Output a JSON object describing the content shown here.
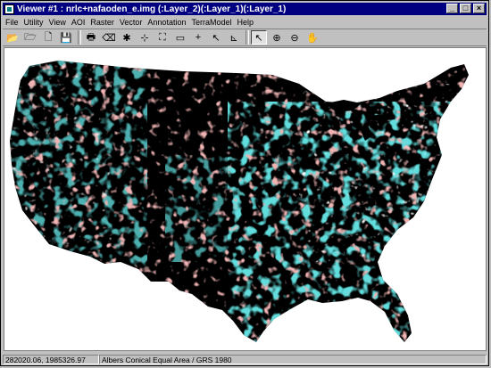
{
  "window": {
    "title": "Viewer #1 : nrlc+nafaoden_e.img (:Layer_2)(:Layer_1)(:Layer_1)",
    "buttons": [
      "_",
      "□",
      "×"
    ]
  },
  "menu": [
    "File",
    "Utility",
    "View",
    "AOI",
    "Raster",
    "Vector",
    "Annotation",
    "TerraModel",
    "Help"
  ],
  "toolbar": {
    "tools": [
      {
        "name": "open-icon",
        "glyph": "📂"
      },
      {
        "name": "open-layer-icon",
        "glyph": "🗁"
      },
      {
        "name": "new-icon",
        "glyph": "🗋"
      },
      {
        "name": "save-icon",
        "glyph": "💾"
      },
      {
        "name": "print-icon",
        "glyph": "🖶"
      },
      {
        "name": "clear-icon",
        "glyph": "⌫"
      },
      {
        "name": "inquire-icon",
        "glyph": "✱"
      },
      {
        "name": "zoom-extent-icon",
        "glyph": "⊹"
      },
      {
        "name": "fit-icon",
        "glyph": "⛶"
      },
      {
        "name": "measure-icon",
        "glyph": "▭"
      },
      {
        "name": "crosshair-icon",
        "glyph": "+"
      },
      {
        "name": "reset-icon",
        "glyph": "↖"
      },
      {
        "name": "profile-icon",
        "glyph": "⊾"
      },
      {
        "name": "select-arrow-icon",
        "glyph": "↖",
        "pressed": true
      },
      {
        "name": "zoom-in-icon",
        "glyph": "⊕"
      },
      {
        "name": "zoom-out-icon",
        "glyph": "⊖"
      },
      {
        "name": "pan-hand-icon",
        "glyph": "✋"
      }
    ]
  },
  "status": {
    "coordinates": "282020.06, 1985326.97",
    "projection": "Albers Conical Equal Area / GRS 1980"
  },
  "colors": {
    "titlebar": "#000080",
    "land": "#000000",
    "vegetation": "#1fb4b4",
    "urban": "#d87070"
  }
}
